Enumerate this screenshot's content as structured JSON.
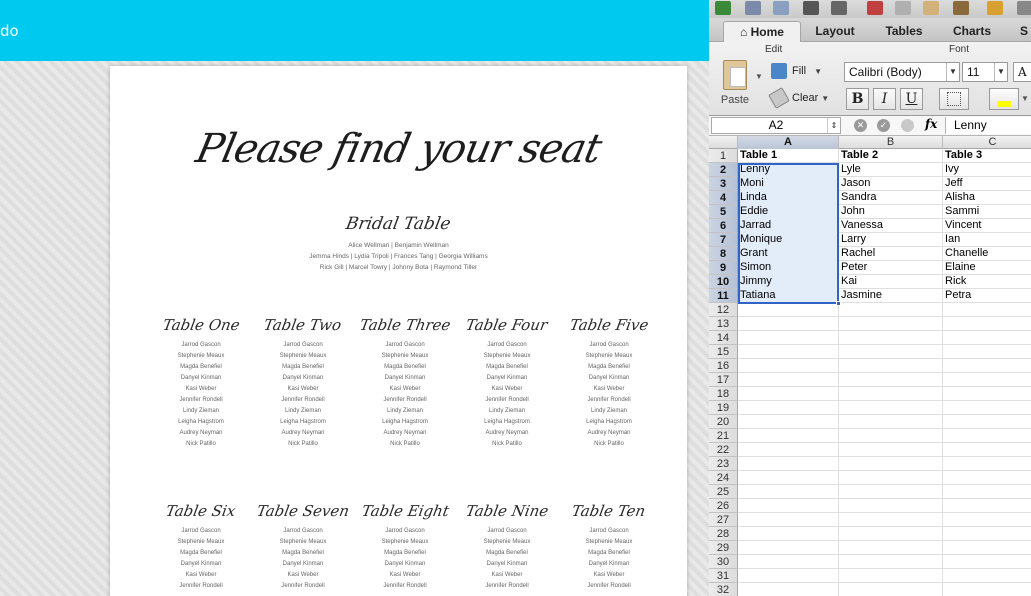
{
  "editor": {
    "topbar_text": "do",
    "document": {
      "title": "Please find your seat",
      "bridal_table": {
        "heading": "Bridal Table",
        "lines": [
          "Alice Wellman | Benjamin Wellman",
          "Jemma Hinds | Lydia Tripoli | Frances Tang | Georgia Williams",
          "Rick Gill | Marcel Towry | Johnny Bota | Raymond Tiller"
        ]
      },
      "tables_row1": [
        {
          "heading": "Table One",
          "guests": [
            "Jarrod Gascon",
            "Stephenie Meaux",
            "Magda Benefiel",
            "Danyel Kinman",
            "Kasi Weber",
            "Jennifer Rondell",
            "Lindy Zieman",
            "Leigha Hagstrom",
            "Audrey Neyman",
            "Nick Patillo"
          ]
        },
        {
          "heading": "Table Two",
          "guests": [
            "Jarrod Gascon",
            "Stephenie Meaux",
            "Magda Benefiel",
            "Danyel Kinman",
            "Kasi Weber",
            "Jennifer Rondell",
            "Lindy Zieman",
            "Leigha Hagstrom",
            "Audrey Neyman",
            "Nick Patillo"
          ]
        },
        {
          "heading": "Table Three",
          "guests": [
            "Jarrod Gascon",
            "Stephenie Meaux",
            "Magda Benefiel",
            "Danyel Kinman",
            "Kasi Weber",
            "Jennifer Rondell",
            "Lindy Zieman",
            "Leigha Hagstrom",
            "Audrey Neyman",
            "Nick Patillo"
          ]
        },
        {
          "heading": "Table Four",
          "guests": [
            "Jarrod Gascon",
            "Stephenie Meaux",
            "Magda Benefiel",
            "Danyel Kinman",
            "Kasi Weber",
            "Jennifer Rondell",
            "Lindy Zieman",
            "Leigha Hagstrom",
            "Audrey Neyman",
            "Nick Patillo"
          ]
        },
        {
          "heading": "Table Five",
          "guests": [
            "Jarrod Gascon",
            "Stephenie Meaux",
            "Magda Benefiel",
            "Danyel Kinman",
            "Kasi Weber",
            "Jennifer Rondell",
            "Lindy Zieman",
            "Leigha Hagstrom",
            "Audrey Neyman",
            "Nick Patillo"
          ]
        }
      ],
      "tables_row2": [
        {
          "heading": "Table Six",
          "guests": [
            "Jarrod Gascon",
            "Stephenie Meaux",
            "Magda Benefiel",
            "Danyel Kinman",
            "Kasi Weber",
            "Jennifer Rondell"
          ]
        },
        {
          "heading": "Table Seven",
          "guests": [
            "Jarrod Gascon",
            "Stephenie Meaux",
            "Magda Benefiel",
            "Danyel Kinman",
            "Kasi Weber",
            "Jennifer Rondell"
          ]
        },
        {
          "heading": "Table Eight",
          "guests": [
            "Jarrod Gascon",
            "Stephenie Meaux",
            "Magda Benefiel",
            "Danyel Kinman",
            "Kasi Weber",
            "Jennifer Rondell"
          ]
        },
        {
          "heading": "Table Nine",
          "guests": [
            "Jarrod Gascon",
            "Stephenie Meaux",
            "Magda Benefiel",
            "Danyel Kinman",
            "Kasi Weber",
            "Jennifer Rondell"
          ]
        },
        {
          "heading": "Table Ten",
          "guests": [
            "Jarrod Gascon",
            "Stephenie Meaux",
            "Magda Benefiel",
            "Danyel Kinman",
            "Kasi Weber",
            "Jennifer Rondell"
          ]
        }
      ]
    }
  },
  "excel": {
    "ribbon_tabs": [
      "Home",
      "Layout",
      "Tables",
      "Charts",
      "S"
    ],
    "active_tab": "Home",
    "groups": {
      "edit": "Edit",
      "font": "Font"
    },
    "paste_label": "Paste",
    "fill_label": "Fill",
    "clear_label": "Clear",
    "font_name": "Calibri (Body)",
    "font_size": "11",
    "format_buttons": [
      "B",
      "I",
      "U"
    ],
    "name_box": "A2",
    "formula_value": "Lenny",
    "fx_label": "fx",
    "columns": [
      "A",
      "B",
      "C"
    ],
    "row_numbers": [
      "1",
      "2",
      "3",
      "4",
      "5",
      "6",
      "7",
      "8",
      "9",
      "10",
      "11",
      "12",
      "13",
      "14",
      "15",
      "16",
      "17",
      "18",
      "19",
      "20",
      "21",
      "22",
      "23",
      "24",
      "25",
      "26",
      "27",
      "28",
      "29",
      "30",
      "31",
      "32"
    ],
    "cells": [
      [
        "Table 1",
        "Table 2",
        "Table 3"
      ],
      [
        "Lenny",
        "Lyle",
        "Ivy"
      ],
      [
        "Moni",
        "Jason",
        "Jeff"
      ],
      [
        "Linda",
        "Sandra",
        "Alisha"
      ],
      [
        "Eddie",
        "John",
        "Sammi"
      ],
      [
        "Jarrad",
        "Vanessa",
        "Vincent"
      ],
      [
        "Monique",
        "Larry",
        "Ian"
      ],
      [
        "Grant",
        "Rachel",
        "Chanelle"
      ],
      [
        "Simon",
        "Peter",
        "Elaine"
      ],
      [
        "Jimmy",
        "Kai",
        "Rick"
      ],
      [
        "Tatiana",
        "Jasmine",
        "Petra"
      ]
    ],
    "colors": {
      "selection": "#2f63c6",
      "selected_fill": "#e3edf9",
      "topbar": "#00c9ef"
    }
  }
}
